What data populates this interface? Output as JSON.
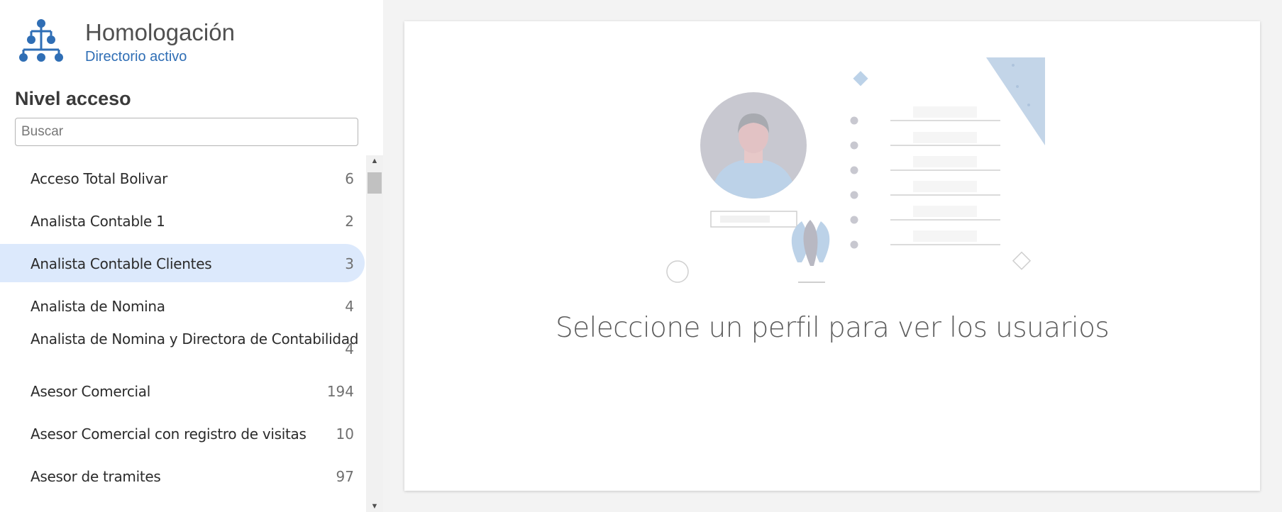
{
  "header": {
    "title": "Homologación",
    "subtitle": "Directorio activo",
    "logo_icon": "org-chart-icon",
    "accent_color": "#2f6eb5"
  },
  "sidebar": {
    "section_title": "Nivel acceso",
    "search": {
      "placeholder": "Buscar",
      "value": ""
    },
    "items": [
      {
        "label": "Acceso Total Bolivar",
        "count": "6",
        "selected": false
      },
      {
        "label": "Analista Contable 1",
        "count": "2",
        "selected": false
      },
      {
        "label": "Analista Contable Clientes",
        "count": "3",
        "selected": true
      },
      {
        "label": "Analista de Nomina",
        "count": "4",
        "selected": false
      },
      {
        "label": "Analista de Nomina y Directora de Contabilidad",
        "count": "4",
        "selected": false
      },
      {
        "label": "Asesor Comercial",
        "count": "194",
        "selected": false
      },
      {
        "label": "Asesor Comercial con registro de visitas",
        "count": "10",
        "selected": false
      },
      {
        "label": "Asesor de tramites",
        "count": "97",
        "selected": false
      }
    ],
    "selected_color": "#dce9fc"
  },
  "main": {
    "empty_state_message": "Seleccione un perfil para ver los usuarios",
    "illustration_icon": "user-profile-illustration"
  }
}
